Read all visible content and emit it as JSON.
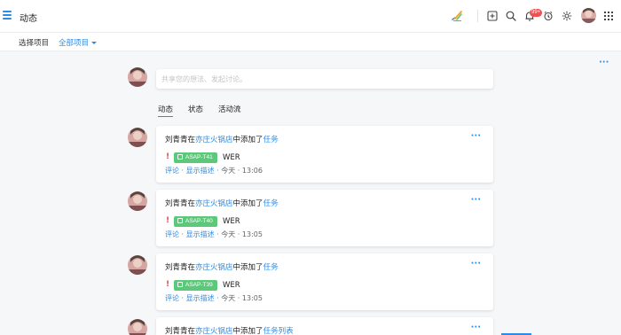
{
  "header": {
    "title": "动态",
    "notification_count": "99+"
  },
  "filter_bar": {
    "label": "选择项目",
    "selected_project": "全部项目"
  },
  "composer": {
    "placeholder": "共享您的想法、发起讨论。"
  },
  "tabs": [
    {
      "label": "动态",
      "active": true
    },
    {
      "label": "状态",
      "active": false
    },
    {
      "label": "活动流",
      "active": false
    }
  ],
  "feed": [
    {
      "user": "刘青青",
      "pre": "在",
      "project": "亦庄火锅店",
      "mid": "中添加了",
      "object": "任务",
      "priority_mark": "!",
      "task_id": "ASAP-T41",
      "task_name": "WER",
      "comment": "评论",
      "sep1": " · ",
      "show_desc": "显示描述",
      "time": " · 今天 · 13:06"
    },
    {
      "user": "刘青青",
      "pre": "在",
      "project": "亦庄火锅店",
      "mid": "中添加了",
      "object": "任务",
      "priority_mark": "!",
      "task_id": "ASAP-T40",
      "task_name": "WER",
      "comment": "评论",
      "sep1": " · ",
      "show_desc": "显示描述",
      "time": " · 今天 · 13:05"
    },
    {
      "user": "刘青青",
      "pre": "在",
      "project": "亦庄火锅店",
      "mid": "中添加了",
      "object": "任务",
      "priority_mark": "!",
      "task_id": "ASAP-T39",
      "task_name": "WER",
      "comment": "评论",
      "sep1": " · ",
      "show_desc": "显示描述",
      "time": " · 今天 · 13:05"
    },
    {
      "user": "刘青青",
      "pre": "在",
      "project": "亦庄火锅店",
      "mid": "中添加了",
      "object": "任务列表"
    }
  ],
  "icons": {
    "menu": "hamburger-icon",
    "logo": "brand-logo",
    "add": "add-square-icon",
    "search": "search-icon",
    "bell": "bell-icon",
    "timer": "alarm-clock-icon",
    "settings": "gear-icon",
    "apps": "grid-apps-icon",
    "more": "more-dots-icon"
  },
  "colors": {
    "accent": "#2b8be6",
    "tag_green": "#5cc87a",
    "badge_red": "#f05050",
    "priority_red": "#e14d4d"
  }
}
